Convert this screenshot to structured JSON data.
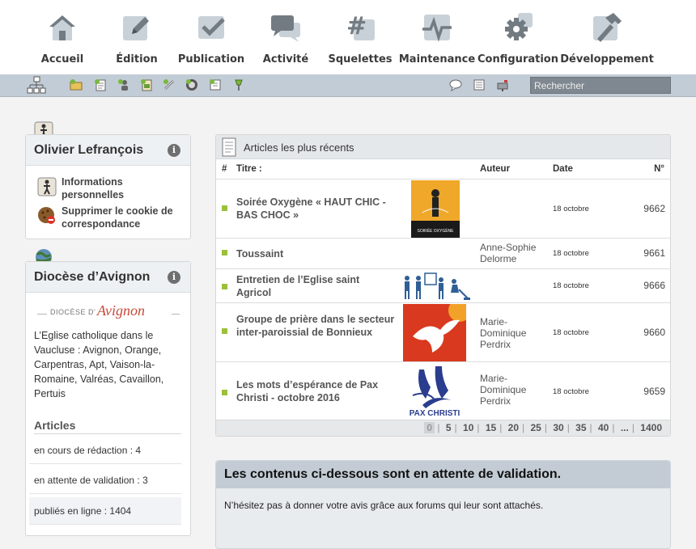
{
  "nav": [
    {
      "label": "Accueil",
      "icon": "home-icon"
    },
    {
      "label": "Édition",
      "icon": "edit-icon"
    },
    {
      "label": "Publication",
      "icon": "publish-check-icon"
    },
    {
      "label": "Activité",
      "icon": "chat-bubbles-icon"
    },
    {
      "label": "Squelettes",
      "icon": "hash-icon"
    },
    {
      "label": "Maintenance",
      "icon": "pulse-icon"
    },
    {
      "label": "Configuration",
      "icon": "gear-icon"
    },
    {
      "label": "Développement",
      "icon": "hammer-icon"
    }
  ],
  "toolbar": {
    "search_placeholder": "Rechercher",
    "icons": [
      "sitemap-icon",
      "new-folder-icon",
      "new-article-icon",
      "new-author-icon",
      "new-document-icon",
      "link-icon",
      "user-add-icon",
      "new-page-icon",
      "pin-icon",
      "forum-icon",
      "page-list-icon",
      "mailbox-icon"
    ]
  },
  "user_box": {
    "title": "Olivier Lefrançois",
    "links": [
      "Informations personnelles",
      "Supprimer le cookie de correspondance"
    ]
  },
  "site_box": {
    "title": "Diocèse d’Avignon",
    "logo_text": "DIOCÈSE D' Avignon",
    "description": "L’Eglise catholique dans le Vaucluse : Avignon, Orange, Carpentras, Apt, Vaison-la-Romaine, Valréas, Cavaillon, Pertuis",
    "articles_heading": "Articles",
    "stats": [
      "en cours de rédaction : 4",
      "en attente de validation : 3",
      "publiés en ligne : 1404"
    ]
  },
  "recent": {
    "title": "Articles les plus récents",
    "columns": {
      "hash": "#",
      "title": "Titre :",
      "author": "Auteur",
      "date": "Date",
      "num": "N°"
    },
    "rows": [
      {
        "title": "Soirée Oxygène « HAUT CHIC - BAS CHOC »",
        "author": "",
        "date": "18 octobre",
        "num": "9662",
        "thumb_caption": "SOIRÉE OXYGÈNE"
      },
      {
        "title": "Toussaint",
        "author": "Anne-Sophie Delorme",
        "date": "18 octobre",
        "num": "9661"
      },
      {
        "title": "Entretien de l’Eglise saint Agricol",
        "author": "",
        "date": "18 octobre",
        "num": "9666"
      },
      {
        "title": "Groupe de prière dans le secteur inter-paroissial de Bonnieux",
        "author": "Marie-Dominique Perdrix",
        "date": "18 octobre",
        "num": "9660"
      },
      {
        "title": "Les mots d’espérance de Pax Christi - octobre 2016",
        "author": "Marie-Dominique Perdrix",
        "date": "18 octobre",
        "num": "9659",
        "thumb_caption": "PAX CHRISTI"
      }
    ],
    "pagination": [
      "0",
      "5",
      "10",
      "15",
      "20",
      "25",
      "30",
      "35",
      "40",
      "...",
      "1400"
    ]
  },
  "validation": {
    "heading": "Les contenus ci-dessous sont en attente de validation.",
    "text": "N’hésitez pas à donner votre avis grâce aux forums qui leur sont attachés."
  },
  "colors": {
    "accent_green": "#9cc03b",
    "toolbar": "#c2ccd6",
    "icon_grey": "#737b82"
  }
}
